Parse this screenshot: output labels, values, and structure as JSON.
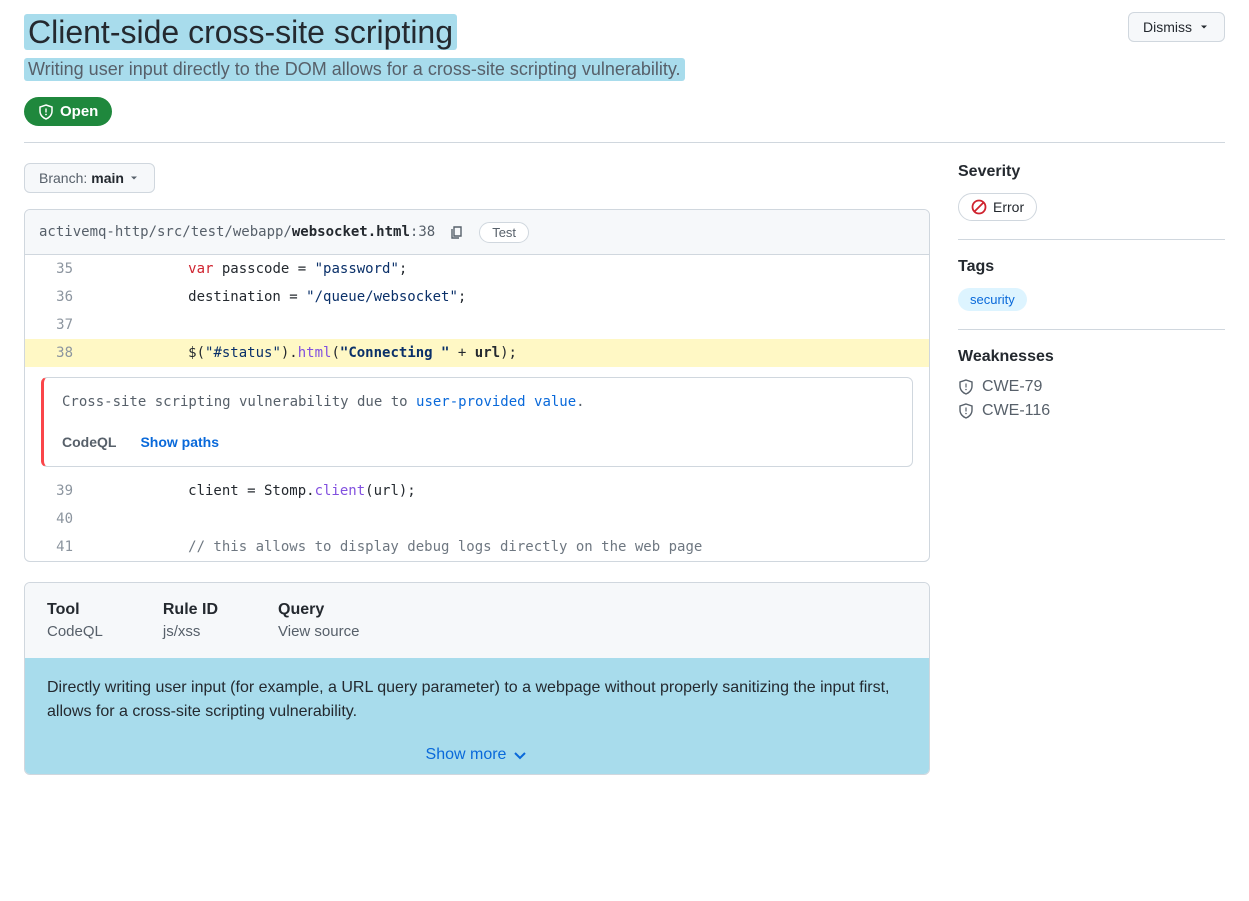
{
  "header": {
    "title": "Client-side cross-site scripting",
    "subtitle": "Writing user input directly to the DOM allows for a cross-site scripting vulnerability.",
    "dismiss": "Dismiss",
    "status": "Open"
  },
  "branch": {
    "label": "Branch:",
    "name": "main"
  },
  "code": {
    "path_prefix": "activemq-http/src/test/webapp/",
    "path_bold": "websocket.html",
    "path_suffix": ":38",
    "test_btn": "Test",
    "lines": {
      "l35": "35",
      "l36": "36",
      "l37": "37",
      "l38": "38",
      "l39": "39",
      "l40": "40",
      "l41": "41"
    },
    "c35_kw": "var",
    "c35_rest": " passcode = ",
    "c35_str": "\"password\"",
    "c35_end": ";",
    "c36_a": "            destination = ",
    "c36_str": "\"/queue/websocket\"",
    "c36_end": ";",
    "c38_a": "            $(",
    "c38_str1": "\"#status\"",
    "c38_b": ").",
    "c38_fn": "html",
    "c38_c": "(",
    "c38_str2": "\"Connecting \"",
    "c38_d": " + ",
    "c38_url": "url",
    "c38_e": ");",
    "c39_a": "            client = Stomp.",
    "c39_fn": "client",
    "c39_b": "(url);",
    "c41_com": "            // this allows to display debug logs directly on the web page"
  },
  "alert": {
    "msg_a": "Cross-site scripting vulnerability due to ",
    "msg_link": "user-provided value",
    "msg_b": ".",
    "tool": "CodeQL",
    "show_paths": "Show paths"
  },
  "meta": {
    "tool_label": "Tool",
    "tool_value": "CodeQL",
    "rule_label": "Rule ID",
    "rule_value": "js/xss",
    "query_label": "Query",
    "query_value": "View source",
    "description": "Directly writing user input (for example, a URL query parameter) to a webpage without properly sanitizing the input first, allows for a cross-site scripting vulnerability.",
    "show_more": "Show more"
  },
  "side": {
    "severity_title": "Severity",
    "severity_value": "Error",
    "tags_title": "Tags",
    "tag1": "security",
    "weak_title": "Weaknesses",
    "weak1": "CWE-79",
    "weak2": "CWE-116"
  }
}
